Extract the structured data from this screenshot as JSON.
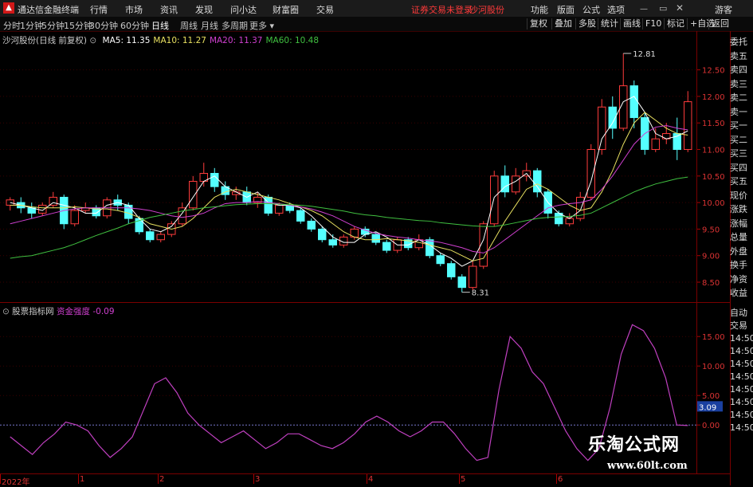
{
  "app": {
    "title": "通达信金融终端",
    "menu": [
      "行情",
      "市场",
      "资讯",
      "发现",
      "问小达",
      "财富圈",
      "交易"
    ],
    "warning": "证券交易未登录",
    "stock_name_top": "沙河股份",
    "right_menu": [
      "功能",
      "版面",
      "公式",
      "选项"
    ],
    "guest": "游客"
  },
  "period_bar": {
    "periods": [
      "分时",
      "1分钟",
      "5分钟",
      "15分钟",
      "30分钟",
      "60分钟",
      "日线",
      "周线",
      "月线",
      "多周期",
      "更多"
    ],
    "active": "日线",
    "tools": [
      "复权",
      "叠加",
      "多股",
      "统计",
      "画线",
      "F10",
      "标记",
      "+自选",
      "返回"
    ]
  },
  "main_chart": {
    "title": "沙河股份(日线 前复权)",
    "ma": [
      {
        "label": "MA5: 11.35",
        "color": "#ffffff"
      },
      {
        "label": "MA10: 11.27",
        "color": "#e8e060"
      },
      {
        "label": "MA20: 11.37",
        "color": "#d040d0"
      },
      {
        "label": "MA60: 10.48",
        "color": "#40c040"
      }
    ],
    "y_ticks": [
      "12.50",
      "12.00",
      "11.50",
      "11.00",
      "10.50",
      "10.00",
      "9.50",
      "9.00",
      "8.50"
    ],
    "high_label": "12.81",
    "low_label": "8.31"
  },
  "indicator": {
    "source": "股票指标网",
    "name": "资金强度",
    "value": "-0.09",
    "y_ticks": [
      "15.00",
      "10.00",
      "5.00",
      "0.00"
    ],
    "current": "3.09"
  },
  "x_axis": [
    "2022年",
    "1",
    "2",
    "3",
    "4",
    "5",
    "6"
  ],
  "right_panel": {
    "upper": [
      "委托",
      "卖五",
      "卖四",
      "卖三",
      "卖二",
      "卖一",
      "买一",
      "买二",
      "买三",
      "买四",
      "买五",
      "现价",
      "涨跌",
      "涨幅",
      "总量",
      "外盘",
      "换手",
      "净资",
      "收益"
    ],
    "lower": [
      "自动",
      "交易",
      "14:50",
      "14:50",
      "14:50",
      "14:50",
      "14:50",
      "14:50",
      "14:50",
      "14:50"
    ]
  },
  "watermark": {
    "cn": "乐淘公式网",
    "url": "www.60lt.com"
  },
  "chart_data": {
    "type": "line",
    "series": [
      {
        "name": "MA5",
        "color": "#ffffff",
        "values": [
          10.0,
          9.95,
          9.9,
          9.85,
          10.0,
          9.95,
          9.9,
          9.8,
          9.8,
          9.95,
          10.0,
          9.95,
          9.7,
          9.5,
          9.45,
          9.55,
          9.8,
          10.1,
          10.4,
          10.5,
          10.3,
          10.2,
          10.1,
          10.2,
          10.0,
          9.95,
          9.95,
          9.9,
          9.75,
          9.55,
          9.35,
          9.25,
          9.25,
          9.4,
          9.45,
          9.35,
          9.2,
          9.2,
          9.3,
          9.2,
          9.05,
          8.95,
          8.8,
          8.9,
          9.3,
          10.1,
          10.3,
          10.4,
          10.55,
          10.3,
          10.0,
          9.8,
          9.7,
          9.85,
          10.4,
          11.2,
          11.5,
          11.9,
          12.0,
          11.7,
          11.3,
          11.2,
          11.25,
          11.35
        ]
      },
      {
        "name": "MA10",
        "color": "#e8e060",
        "values": [
          9.95,
          9.95,
          9.92,
          9.9,
          9.9,
          9.9,
          9.92,
          9.9,
          9.88,
          9.88,
          9.85,
          9.8,
          9.72,
          9.6,
          9.55,
          9.5,
          9.55,
          9.7,
          9.9,
          10.1,
          10.2,
          10.25,
          10.2,
          10.15,
          10.1,
          10.05,
          9.98,
          9.92,
          9.85,
          9.75,
          9.6,
          9.45,
          9.35,
          9.3,
          9.3,
          9.32,
          9.3,
          9.28,
          9.25,
          9.2,
          9.15,
          9.1,
          9.0,
          8.9,
          8.95,
          9.3,
          9.65,
          9.95,
          10.25,
          10.35,
          10.25,
          10.1,
          9.95,
          9.85,
          9.9,
          10.2,
          10.6,
          11.1,
          11.5,
          11.7,
          11.55,
          11.4,
          11.3,
          11.27
        ]
      },
      {
        "name": "MA20",
        "color": "#d040d0",
        "values": [
          9.6,
          9.65,
          9.7,
          9.75,
          9.8,
          9.85,
          9.88,
          9.9,
          9.9,
          9.9,
          9.9,
          9.9,
          9.88,
          9.85,
          9.8,
          9.75,
          9.72,
          9.75,
          9.8,
          9.9,
          9.98,
          10.0,
          10.0,
          10.02,
          10.0,
          9.98,
          9.95,
          9.92,
          9.88,
          9.82,
          9.75,
          9.65,
          9.55,
          9.48,
          9.42,
          9.38,
          9.35,
          9.33,
          9.3,
          9.28,
          9.25,
          9.2,
          9.15,
          9.08,
          9.05,
          9.15,
          9.3,
          9.45,
          9.6,
          9.75,
          9.9,
          9.95,
          9.98,
          10.0,
          10.05,
          10.25,
          10.5,
          10.8,
          11.1,
          11.3,
          11.42,
          11.45,
          11.4,
          11.37
        ]
      },
      {
        "name": "MA60",
        "color": "#40c040",
        "values": [
          8.95,
          8.98,
          9.0,
          9.05,
          9.1,
          9.15,
          9.22,
          9.3,
          9.38,
          9.45,
          9.52,
          9.6,
          9.66,
          9.72,
          9.76,
          9.8,
          9.84,
          9.87,
          9.9,
          9.92,
          9.94,
          9.96,
          9.97,
          9.98,
          9.98,
          9.97,
          9.96,
          9.95,
          9.93,
          9.9,
          9.87,
          9.84,
          9.8,
          9.77,
          9.75,
          9.72,
          9.7,
          9.68,
          9.66,
          9.65,
          9.62,
          9.6,
          9.58,
          9.56,
          9.55,
          9.55,
          9.58,
          9.62,
          9.66,
          9.7,
          9.72,
          9.73,
          9.74,
          9.76,
          9.8,
          9.9,
          10.0,
          10.1,
          10.2,
          10.28,
          10.35,
          10.4,
          10.45,
          10.48
        ]
      }
    ],
    "candles": [
      [
        9.95,
        10.05,
        10.1,
        9.85
      ],
      [
        10.0,
        9.9,
        10.1,
        9.8
      ],
      [
        9.9,
        9.8,
        10.0,
        9.7
      ],
      [
        9.8,
        9.95,
        10.0,
        9.75
      ],
      [
        9.95,
        10.1,
        10.2,
        9.9
      ],
      [
        10.1,
        9.6,
        10.15,
        9.5
      ],
      [
        9.6,
        9.85,
        9.95,
        9.55
      ],
      [
        9.85,
        9.9,
        10.0,
        9.8
      ],
      [
        9.9,
        9.75,
        9.95,
        9.7
      ],
      [
        9.75,
        10.05,
        10.1,
        9.7
      ],
      [
        10.05,
        9.95,
        10.15,
        9.85
      ],
      [
        9.95,
        9.7,
        10.0,
        9.6
      ],
      [
        9.7,
        9.45,
        9.75,
        9.4
      ],
      [
        9.45,
        9.3,
        9.5,
        9.25
      ],
      [
        9.3,
        9.4,
        9.45,
        9.25
      ],
      [
        9.4,
        9.6,
        9.65,
        9.35
      ],
      [
        9.6,
        9.9,
        10.0,
        9.55
      ],
      [
        9.9,
        10.4,
        10.5,
        9.85
      ],
      [
        10.4,
        10.55,
        10.75,
        10.3
      ],
      [
        10.55,
        10.3,
        10.65,
        10.2
      ],
      [
        10.3,
        10.15,
        10.4,
        10.05
      ],
      [
        10.15,
        10.2,
        10.3,
        10.05
      ],
      [
        10.2,
        10.0,
        10.3,
        9.95
      ],
      [
        10.0,
        10.1,
        10.2,
        9.9
      ],
      [
        10.1,
        9.8,
        10.15,
        9.75
      ],
      [
        9.8,
        9.95,
        10.0,
        9.75
      ],
      [
        9.95,
        9.85,
        10.0,
        9.8
      ],
      [
        9.85,
        9.65,
        9.9,
        9.6
      ],
      [
        9.65,
        9.5,
        9.7,
        9.45
      ],
      [
        9.5,
        9.3,
        9.55,
        9.25
      ],
      [
        9.3,
        9.2,
        9.4,
        9.15
      ],
      [
        9.2,
        9.35,
        9.4,
        9.15
      ],
      [
        9.35,
        9.5,
        9.55,
        9.3
      ],
      [
        9.5,
        9.4,
        9.55,
        9.35
      ],
      [
        9.4,
        9.25,
        9.45,
        9.2
      ],
      [
        9.25,
        9.1,
        9.3,
        9.05
      ],
      [
        9.1,
        9.3,
        9.35,
        9.05
      ],
      [
        9.3,
        9.15,
        9.35,
        9.1
      ],
      [
        9.15,
        9.3,
        9.4,
        9.1
      ],
      [
        9.3,
        9.0,
        9.35,
        8.95
      ],
      [
        9.0,
        8.85,
        9.05,
        8.8
      ],
      [
        8.85,
        8.6,
        8.9,
        8.55
      ],
      [
        8.6,
        8.4,
        8.65,
        8.31
      ],
      [
        8.4,
        8.8,
        8.9,
        8.35
      ],
      [
        8.8,
        9.6,
        9.65,
        8.75
      ],
      [
        9.6,
        10.5,
        10.6,
        9.55
      ],
      [
        10.5,
        10.2,
        10.7,
        10.1
      ],
      [
        10.2,
        10.5,
        10.65,
        10.15
      ],
      [
        10.5,
        10.6,
        10.75,
        10.4
      ],
      [
        10.6,
        10.2,
        10.65,
        10.1
      ],
      [
        10.2,
        9.8,
        10.25,
        9.7
      ],
      [
        9.8,
        9.6,
        9.85,
        9.55
      ],
      [
        9.6,
        9.7,
        9.8,
        9.55
      ],
      [
        9.7,
        10.1,
        10.2,
        9.65
      ],
      [
        10.1,
        11.0,
        11.1,
        10.05
      ],
      [
        11.0,
        11.8,
        11.95,
        10.9
      ],
      [
        11.8,
        11.4,
        12.0,
        11.2
      ],
      [
        11.4,
        12.2,
        12.81,
        11.35
      ],
      [
        12.2,
        11.6,
        12.3,
        11.4
      ],
      [
        11.6,
        11.0,
        11.7,
        10.9
      ],
      [
        11.0,
        11.2,
        11.4,
        10.95
      ],
      [
        11.2,
        11.3,
        11.5,
        11.1
      ],
      [
        11.3,
        11.0,
        11.6,
        10.8
      ],
      [
        11.0,
        11.9,
        12.1,
        10.95
      ]
    ],
    "indicator_series": {
      "name": "资金强度",
      "values": [
        -2.0,
        -3.5,
        -5.0,
        -3.0,
        -1.5,
        0.5,
        0.0,
        -1.0,
        -3.5,
        -5.5,
        -4.0,
        -2.0,
        2.5,
        7.0,
        8.0,
        5.5,
        2.0,
        0.0,
        -1.5,
        -3.0,
        -2.0,
        -1.0,
        -2.5,
        -4.0,
        -3.0,
        -1.5,
        -1.5,
        -2.5,
        -3.5,
        -4.0,
        -3.0,
        -1.5,
        0.5,
        1.5,
        0.5,
        -1.0,
        -2.0,
        -1.0,
        0.5,
        0.5,
        -1.5,
        -4.0,
        -6.0,
        -5.5,
        6.0,
        15.0,
        13.0,
        9.0,
        7.0,
        3.0,
        -1.0,
        -4.0,
        -6.0,
        -4.0,
        3.0,
        12.0,
        17.0,
        16.0,
        13.0,
        8.0,
        0.0,
        -0.09
      ]
    },
    "y_range_main": [
      8.2,
      12.9
    ],
    "y_range_indicator": [
      -7,
      18
    ]
  }
}
